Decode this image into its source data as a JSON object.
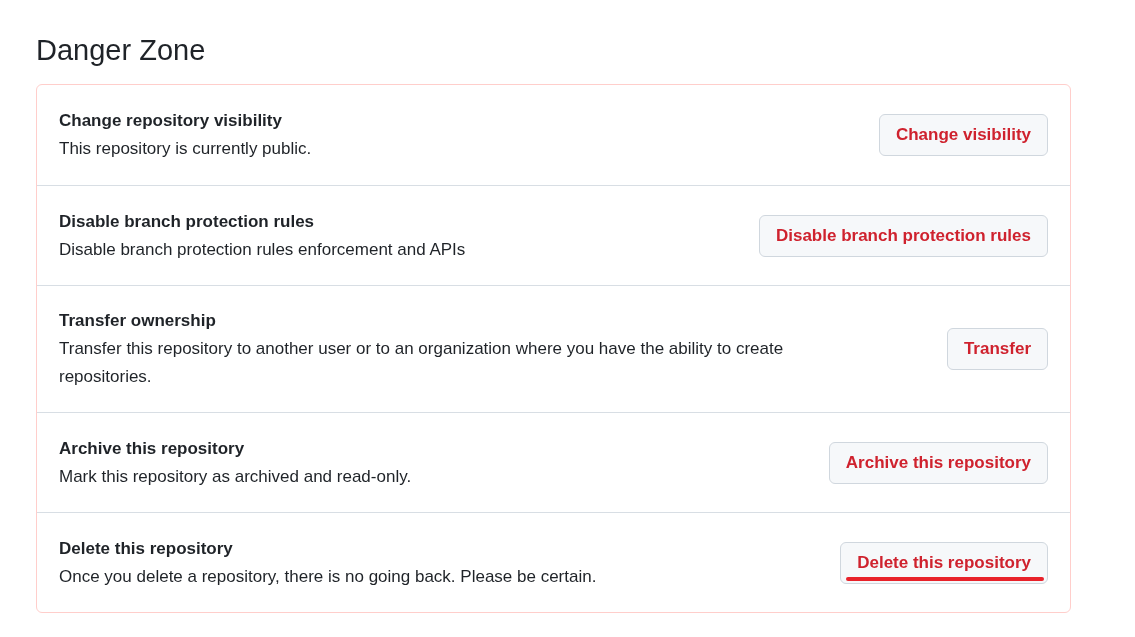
{
  "heading": "Danger Zone",
  "items": [
    {
      "title": "Change repository visibility",
      "description": "This repository is currently public.",
      "button": "Change visibility",
      "underlined": false
    },
    {
      "title": "Disable branch protection rules",
      "description": "Disable branch protection rules enforcement and APIs",
      "button": "Disable branch protection rules",
      "underlined": false
    },
    {
      "title": "Transfer ownership",
      "description": "Transfer this repository to another user or to an organization where you have the ability to create repositories.",
      "button": "Transfer",
      "underlined": false
    },
    {
      "title": "Archive this repository",
      "description": "Mark this repository as archived and read-only.",
      "button": "Archive this repository",
      "underlined": false
    },
    {
      "title": "Delete this repository",
      "description": "Once you delete a repository, there is no going back. Please be certain.",
      "button": "Delete this repository",
      "underlined": true
    }
  ]
}
